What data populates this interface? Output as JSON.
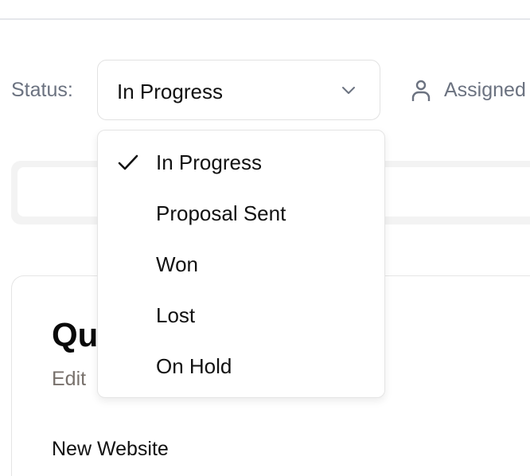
{
  "filters": {
    "status_label": "Status:",
    "status_value": "In Progress",
    "assignee_label": "Assigned"
  },
  "dropdown": {
    "options": [
      {
        "label": "In Progress",
        "selected": true
      },
      {
        "label": "Proposal Sent",
        "selected": false
      },
      {
        "label": "Won",
        "selected": false
      },
      {
        "label": "Lost",
        "selected": false
      },
      {
        "label": "On Hold",
        "selected": false
      }
    ]
  },
  "card": {
    "title": "Qu",
    "edit_label": "Edit",
    "name": "New Website"
  }
}
